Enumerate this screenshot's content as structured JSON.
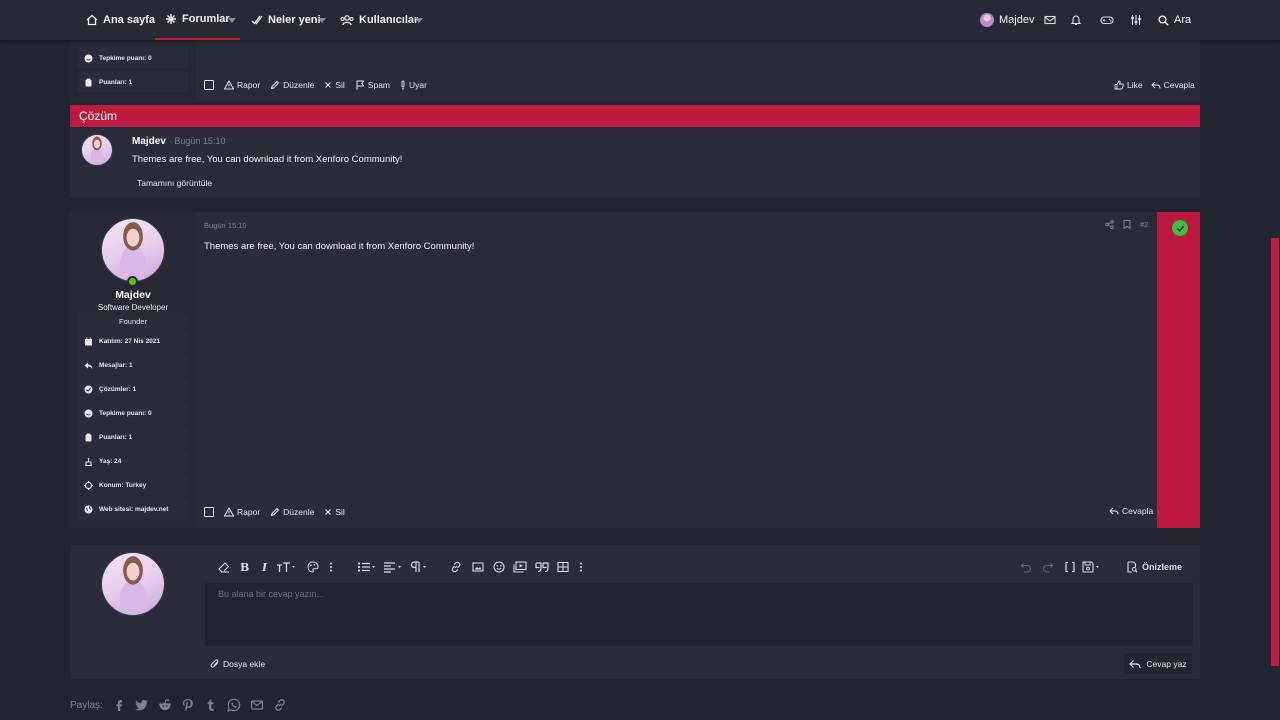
{
  "nav": {
    "home": "Ana sayfa",
    "forums": "Forumlar",
    "whats_new": "Neler yeni",
    "members": "Kullanıcılar",
    "user": "Majdev",
    "search": "Ara"
  },
  "top_panel": {
    "stats": [
      {
        "icon": "smile-icon",
        "text": "Tepkime puanı:  0"
      },
      {
        "icon": "clipboard-icon",
        "text": "Puanları:  1"
      }
    ],
    "actions": {
      "report": "Rapor",
      "edit": "Düzenle",
      "delete": "Sil",
      "spam": "Spam",
      "warn": "Uyar"
    },
    "right": {
      "like": "Like",
      "reply": "Cevapla"
    }
  },
  "solution": {
    "title": "Çözüm",
    "author": "Majdev",
    "time": "· Bugün 15:10",
    "text": "Themes are free, You can download it from Xenforo Community!",
    "view_full": "Tamamını görüntüle"
  },
  "post": {
    "date": "Bugün 15:10",
    "number": "#2",
    "text": "Themes are free, You can download it from Xenforo Community!",
    "user": {
      "name": "Majdev",
      "title": "Software Developer",
      "banner": "Founder",
      "stats": [
        {
          "icon": "calendar-icon",
          "text": "Katılım:  27 Nis 2021"
        },
        {
          "icon": "reply-icon",
          "text": "Mesajlar:  1"
        },
        {
          "icon": "check-circle-icon",
          "text": "Çözümler:  1"
        },
        {
          "icon": "smile-icon",
          "text": "Tepkime puanı:  0"
        },
        {
          "icon": "clipboard-icon",
          "text": "Puanları:  1"
        },
        {
          "icon": "birthday-icon",
          "text": "Yaş:  24"
        },
        {
          "icon": "location-icon",
          "text": "Konum:  Turkey"
        },
        {
          "icon": "globe-icon",
          "text": "Web sitesi:  majdev.net"
        }
      ]
    },
    "actions": {
      "report": "Rapor",
      "edit": "Düzenle",
      "delete": "Sil"
    },
    "reply": "Cevapla"
  },
  "editor": {
    "placeholder": "Bu alana bir cevap yazın...",
    "preview": "Önizleme",
    "attach": "Dosya ekle",
    "submit": "Cevap yaz"
  },
  "share": {
    "label": "Paylaş:",
    "networks": [
      "facebook-icon",
      "twitter-icon",
      "reddit-icon",
      "pinterest-icon",
      "tumblr-icon",
      "whatsapp-icon",
      "email-icon",
      "link-icon"
    ]
  },
  "colors": {
    "accent": "#bd1a3f",
    "background": "#232630",
    "panel": "#2a2d39",
    "online": "#5bc21b",
    "solved": "#3fbf3f"
  }
}
